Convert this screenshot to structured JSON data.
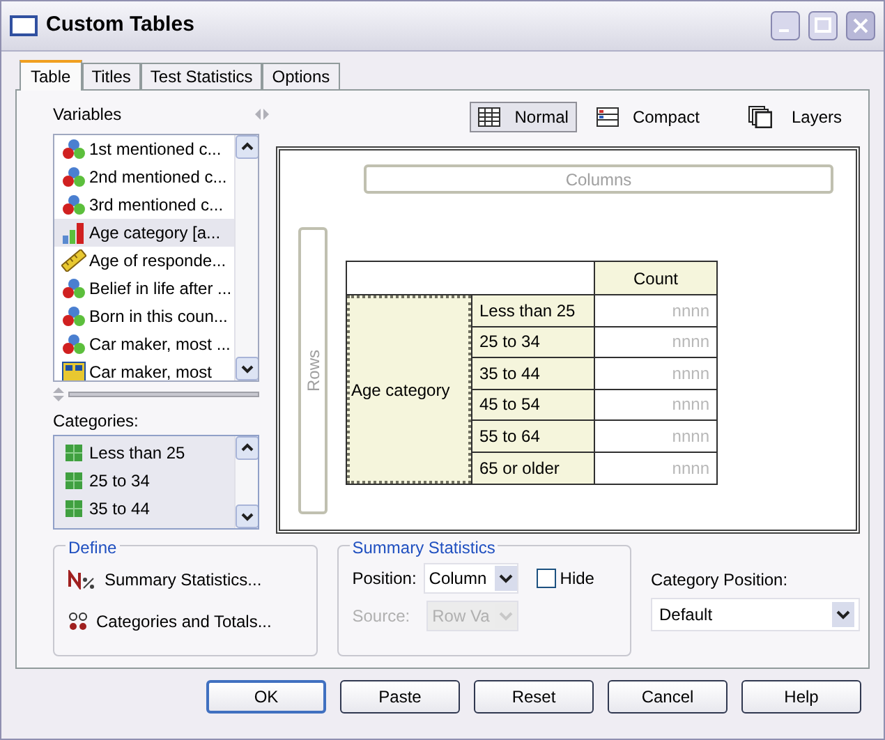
{
  "window": {
    "title": "Custom Tables"
  },
  "tabs": [
    {
      "label": "Table",
      "selected": true
    },
    {
      "label": "Titles",
      "selected": false
    },
    {
      "label": "Test Statistics",
      "selected": false
    },
    {
      "label": "Options",
      "selected": false
    }
  ],
  "variables": {
    "label": "Variables",
    "items": [
      {
        "label": "1st mentioned c...",
        "kind": "nominal",
        "selected": false
      },
      {
        "label": "2nd mentioned c...",
        "kind": "nominal",
        "selected": false
      },
      {
        "label": "3rd mentioned c...",
        "kind": "nominal",
        "selected": false
      },
      {
        "label": "Age category [a...",
        "kind": "ordinal",
        "selected": true
      },
      {
        "label": "Age of responde...",
        "kind": "scale",
        "selected": false
      },
      {
        "label": "Belief in life after ...",
        "kind": "nominal",
        "selected": false
      },
      {
        "label": "Born in this coun...",
        "kind": "nominal",
        "selected": false
      },
      {
        "label": "Car maker, most ...",
        "kind": "nominal",
        "selected": false
      },
      {
        "label": "Car maker, most",
        "kind": "set",
        "selected": false
      }
    ]
  },
  "categories": {
    "label": "Categories:",
    "items": [
      "Less than 25",
      "25 to 34",
      "35 to 44"
    ]
  },
  "view_buttons": [
    {
      "label": "Normal",
      "kind": "normal",
      "selected": true
    },
    {
      "label": "Compact",
      "kind": "compact",
      "selected": false
    }
  ],
  "layers_button": "Layers",
  "canvas": {
    "columns_label": "Columns",
    "rows_label": "Rows",
    "header": "Count",
    "row_variable": "Age category",
    "rows": [
      {
        "label": "Less than 25",
        "value": "nnnn"
      },
      {
        "label": "25 to 34",
        "value": "nnnn"
      },
      {
        "label": "35 to 44",
        "value": "nnnn"
      },
      {
        "label": "45 to 54",
        "value": "nnnn"
      },
      {
        "label": "55 to 64",
        "value": "nnnn"
      },
      {
        "label": "65 or older",
        "value": "nnnn"
      }
    ]
  },
  "define": {
    "title": "Define",
    "links": [
      {
        "label": "Summary Statistics...",
        "kind": "stats"
      },
      {
        "label": "Categories and Totals...",
        "kind": "categories"
      }
    ]
  },
  "summary_statistics": {
    "title": "Summary Statistics",
    "position": {
      "label": "Position:",
      "value": "Column"
    },
    "hide": {
      "label": "Hide",
      "checked": false
    },
    "source": {
      "label": "Source:",
      "value": "Row Va",
      "disabled": true
    }
  },
  "category_position": {
    "label": "Category Position:",
    "value": "Default"
  },
  "buttons": [
    {
      "label": "OK",
      "default": true
    },
    {
      "label": "Paste",
      "default": false
    },
    {
      "label": "Reset",
      "default": false
    },
    {
      "label": "Cancel",
      "default": false
    },
    {
      "label": "Help",
      "default": false
    }
  ]
}
